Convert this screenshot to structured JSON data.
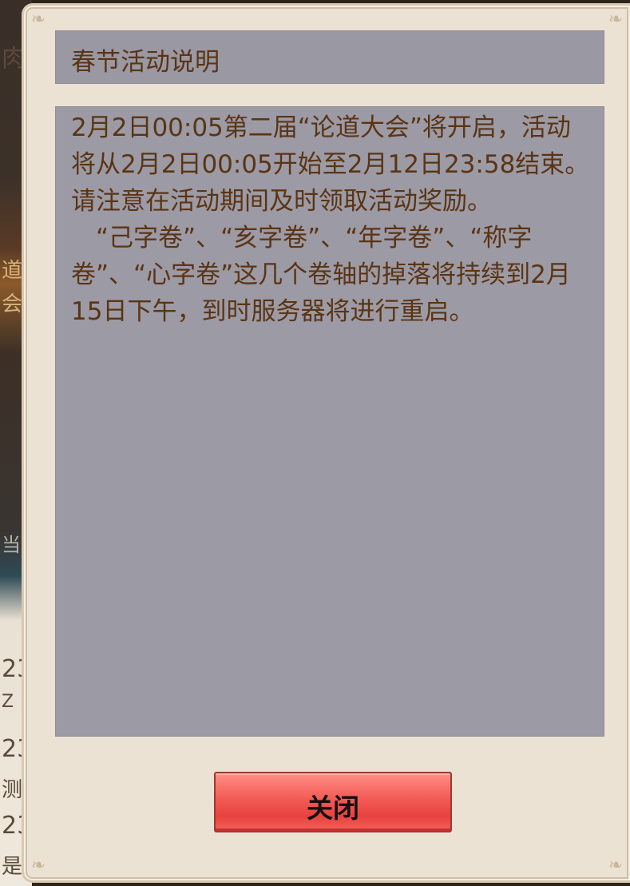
{
  "background": {
    "glyphs": [
      "肉",
      "道",
      "会",
      "当",
      "23",
      "Z",
      "23",
      "测",
      "23",
      "是"
    ]
  },
  "dialog": {
    "title": "春节活动说明",
    "paragraphs": [
      "2月2日00:05第二届“论道大会”将开启，活动将从2月2日00:05开始至2月12日23:58结束。请注意在活动期间及时领取活动奖励。",
      "“己字卷”、“亥字卷”、“年字卷”、“称字卷”、“心字卷”这几个卷轴的掉落将持续到2月15日下午，到时服务器将进行重启。"
    ],
    "close_label": "关闭"
  },
  "colors": {
    "frame": "#ece2d4",
    "panel": "#9c9aa4",
    "text": "#5a3414",
    "button": "#f25a55"
  }
}
